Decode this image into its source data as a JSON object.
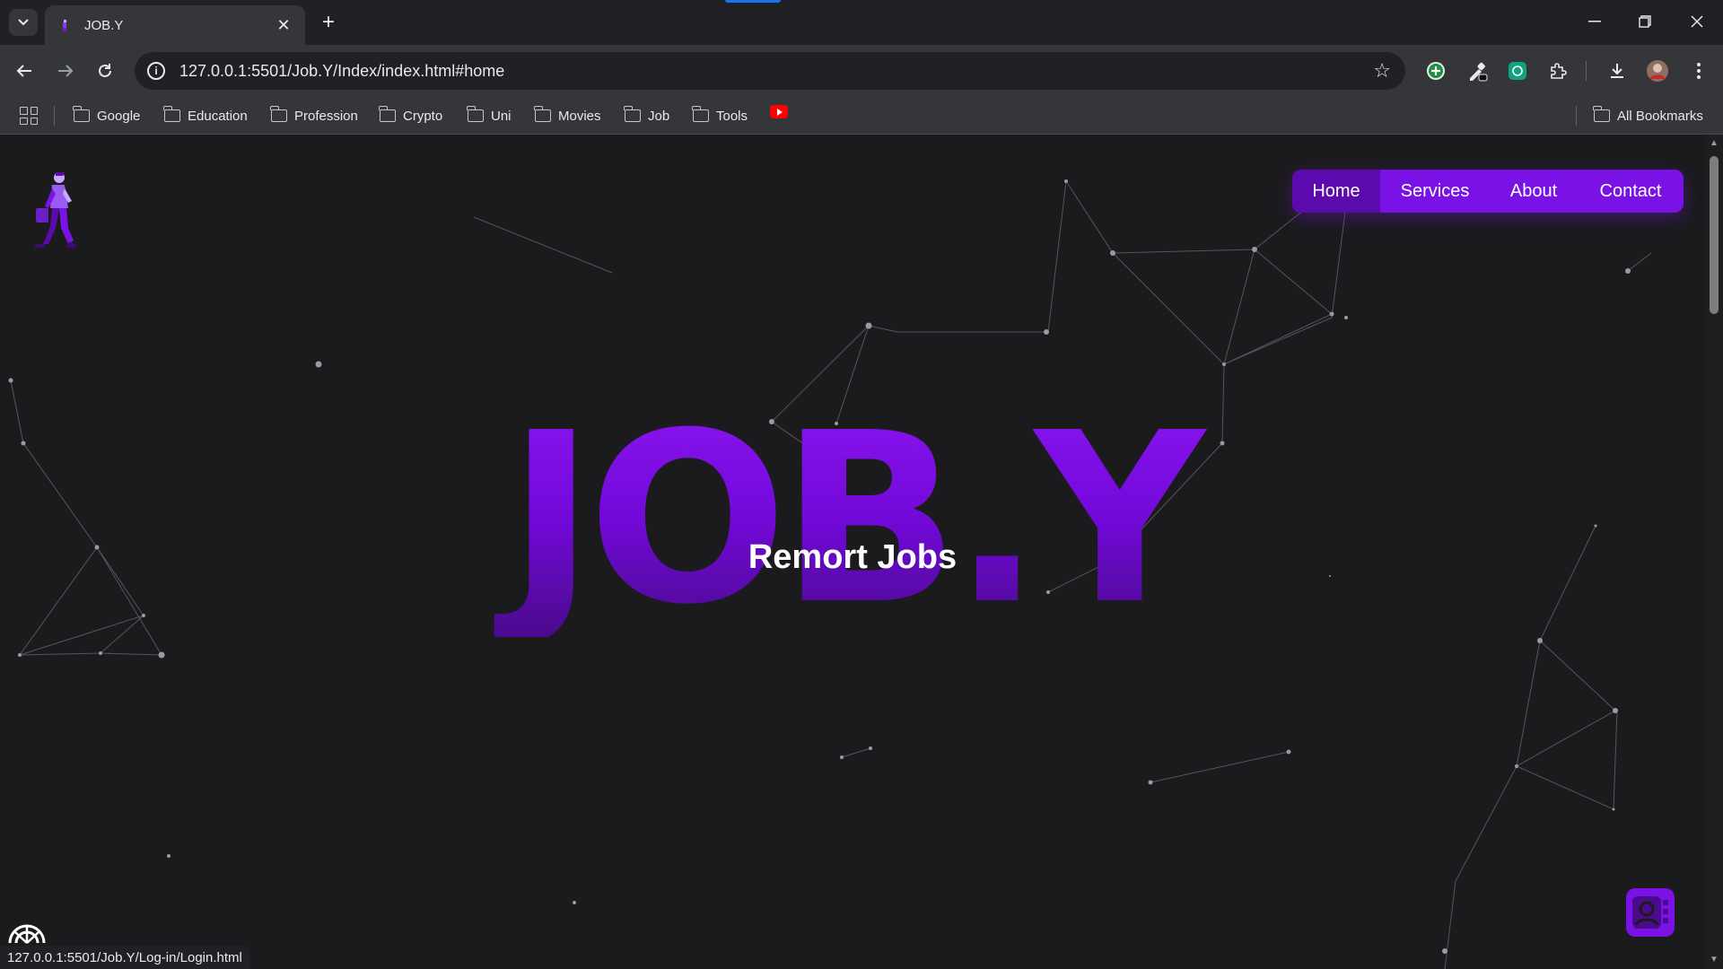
{
  "browser": {
    "tab_title": "JOB.Y",
    "url": "127.0.0.1:5501/Job.Y/Index/index.html#home",
    "bookmarks": [
      {
        "label": "Google"
      },
      {
        "label": "Education"
      },
      {
        "label": "Profession"
      },
      {
        "label": "Crypto"
      },
      {
        "label": "Uni"
      },
      {
        "label": "Movies"
      },
      {
        "label": "Job"
      },
      {
        "label": "Tools"
      }
    ],
    "all_bookmarks_label": "All Bookmarks",
    "status_url": "127.0.0.1:5501/Job.Y/Log-in/Login.html"
  },
  "nav": {
    "items": [
      {
        "label": "Home",
        "active": true
      },
      {
        "label": "Services"
      },
      {
        "label": "About"
      },
      {
        "label": "Contact"
      }
    ]
  },
  "hero": {
    "title": "JOB.Y",
    "subtitle": "Remort Jobs"
  },
  "colors": {
    "accent": "#7a12e6",
    "accent_dark": "#5a0aad",
    "background": "#1b1b1e"
  }
}
